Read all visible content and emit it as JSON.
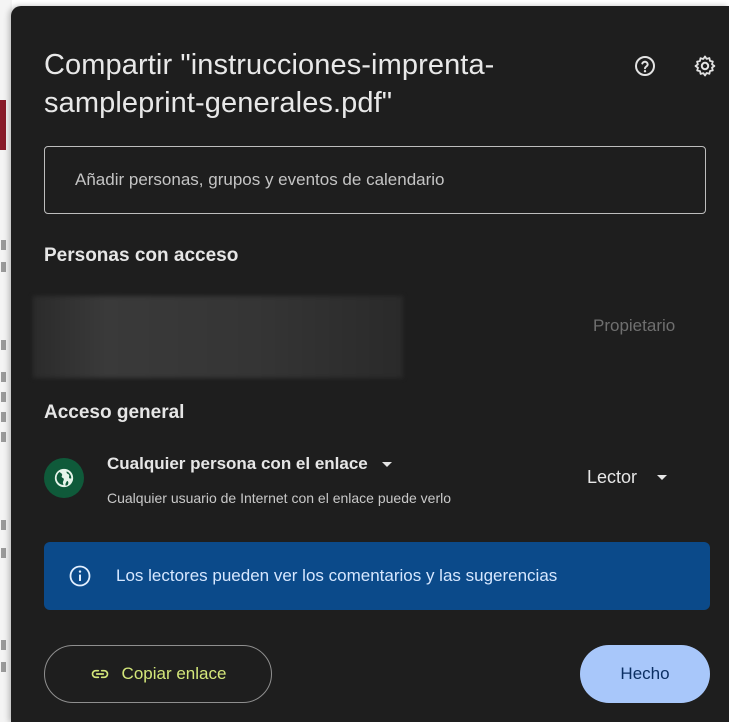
{
  "dialog": {
    "title": "Compartir \"instrucciones-imprenta-sampleprint-generales.pdf\"",
    "help_icon": "help-circle-icon",
    "settings_icon": "gear-icon"
  },
  "add_people": {
    "placeholder": "Añadir personas, grupos y eventos de calendario"
  },
  "people_with_access": {
    "heading": "Personas con acceso",
    "owner_role": "Propietario"
  },
  "general_access": {
    "heading": "Acceso general",
    "icon": "globe-icon",
    "access_level": "Cualquier persona con el enlace",
    "description": "Cualquier usuario de Internet con el enlace puede verlo",
    "role": "Lector"
  },
  "info_banner": {
    "icon": "info-icon",
    "text": "Los lectores pueden ver los comentarios y las sugerencias"
  },
  "footer": {
    "copy_link_label": "Copiar enlace",
    "done_label": "Hecho"
  },
  "colors": {
    "dialog_bg": "#1e1e1e",
    "banner_bg": "#0b4a8a",
    "primary_button": "#a8c7fa",
    "link_accent": "#d4e77a",
    "globe_bg": "#0f5a3a"
  }
}
